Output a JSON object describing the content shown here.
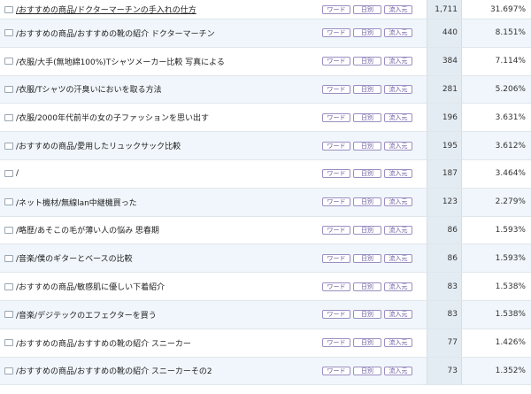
{
  "buttons": {
    "word": "ワード",
    "daily": "日別",
    "referrer": "流入元"
  },
  "rows": [
    {
      "page": "/おすすめの商品/ドクターマーチンの手入れの仕方",
      "count": "1,711",
      "percent": "31.697%"
    },
    {
      "page": "/おすすめの商品/おすすめの靴の紹介 ドクターマーチン",
      "count": "440",
      "percent": "8.151%"
    },
    {
      "page": "/衣服/大手(無地綿100%)Tシャツメーカー比較 写真による",
      "count": "384",
      "percent": "7.114%"
    },
    {
      "page": "/衣服/Tシャツの汗臭いにおいを取る方法",
      "count": "281",
      "percent": "5.206%"
    },
    {
      "page": "/衣服/2000年代前半の女の子ファッションを思い出す",
      "count": "196",
      "percent": "3.631%"
    },
    {
      "page": "/おすすめの商品/愛用したリュックサック比較",
      "count": "195",
      "percent": "3.612%"
    },
    {
      "page": "/",
      "count": "187",
      "percent": "3.464%"
    },
    {
      "page": "/ネット機材/無線lan中継機買った",
      "count": "123",
      "percent": "2.279%"
    },
    {
      "page": "/略歴/あそこの毛が薄い人の悩み 思春期",
      "count": "86",
      "percent": "1.593%"
    },
    {
      "page": "/音楽/僕のギターとベースの比較",
      "count": "86",
      "percent": "1.593%"
    },
    {
      "page": "/おすすめの商品/敏感肌に優しい下着紹介",
      "count": "83",
      "percent": "1.538%"
    },
    {
      "page": "/音楽/デジテックのエフェクターを買う",
      "count": "83",
      "percent": "1.538%"
    },
    {
      "page": "/おすすめの商品/おすすめの靴の紹介 スニーカー",
      "count": "77",
      "percent": "1.426%"
    },
    {
      "page": "/おすすめの商品/おすすめの靴の紹介 スニーカーその2",
      "count": "73",
      "percent": "1.352%"
    }
  ]
}
